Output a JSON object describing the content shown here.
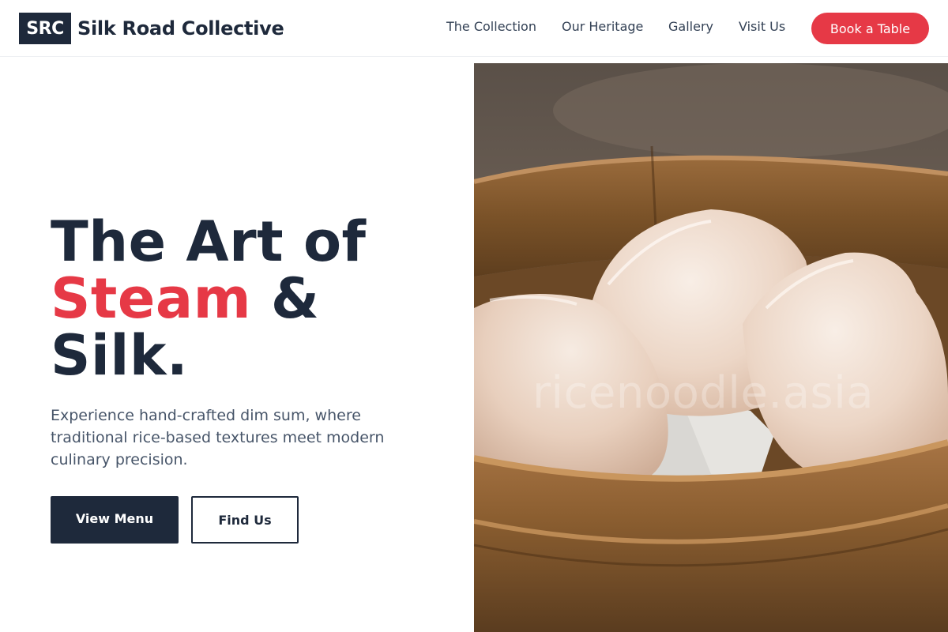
{
  "brand": {
    "mark": "SRC",
    "name": "Silk Road Collective"
  },
  "nav": {
    "links": [
      "The Collection",
      "Our Heritage",
      "Gallery",
      "Visit Us"
    ],
    "cta": "Book a Table"
  },
  "hero": {
    "title_line1": "The Art of",
    "title_accent": "Steam",
    "title_line2_rest": " &",
    "title_line3": "Silk.",
    "description": "Experience hand-crafted dim sum, where traditional rice-based textures meet modern culinary precision.",
    "primary_button": "View Menu",
    "secondary_button": "Find Us"
  },
  "image": {
    "subject": "dumplings-in-bamboo-steamer",
    "watermark": "ricenoodle.asia"
  },
  "colors": {
    "primary": "#1e293b",
    "accent": "#e63946",
    "text_muted": "#475569"
  }
}
